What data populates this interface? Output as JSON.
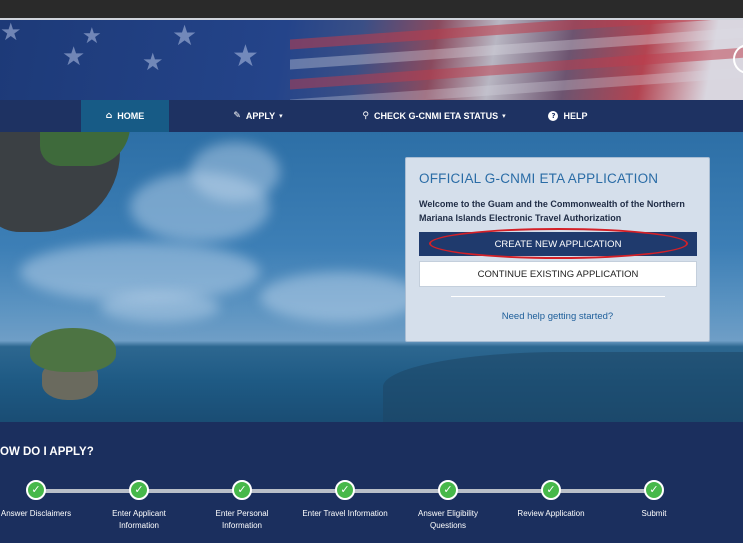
{
  "nav": {
    "items": [
      {
        "icon": "home-icon",
        "glyph": "⌂",
        "label": "HOME",
        "dropdown": false
      },
      {
        "icon": "pencil-icon",
        "glyph": "✎",
        "label": "APPLY",
        "dropdown": true
      },
      {
        "icon": "search-icon",
        "glyph": "⚲",
        "label": "CHECK G-CNMI ETA STATUS",
        "dropdown": true
      },
      {
        "icon": "help-icon",
        "glyph": "?",
        "label": "HELP",
        "dropdown": false
      }
    ],
    "caret": "▾"
  },
  "panel": {
    "title": "OFFICIAL G-CNMI ETA APPLICATION",
    "welcome": "Welcome to the Guam and the Commonwealth of the Northern Mariana Islands Electronic Travel Authorization",
    "create_label": "CREATE NEW APPLICATION",
    "continue_label": "CONTINUE EXISTING APPLICATION",
    "help_link": "Need help getting started?",
    "highlight_color": "#d32027"
  },
  "howto": {
    "title": "OW DO I APPLY?",
    "check_glyph": "✓",
    "steps": [
      {
        "label": "Answer Disclaimers"
      },
      {
        "label": "Enter Applicant Information"
      },
      {
        "label": "Enter Personal Information"
      },
      {
        "label": "Enter Travel Information"
      },
      {
        "label": "Answer Eligibility Questions"
      },
      {
        "label": "Review Application"
      },
      {
        "label": "Submit"
      }
    ]
  },
  "colors": {
    "navbar": "#1e3262",
    "nav_active": "#175b86",
    "create_button": "#1f3a6d",
    "step_complete": "#47b84a",
    "footer_bg": "#1b2f5e"
  }
}
